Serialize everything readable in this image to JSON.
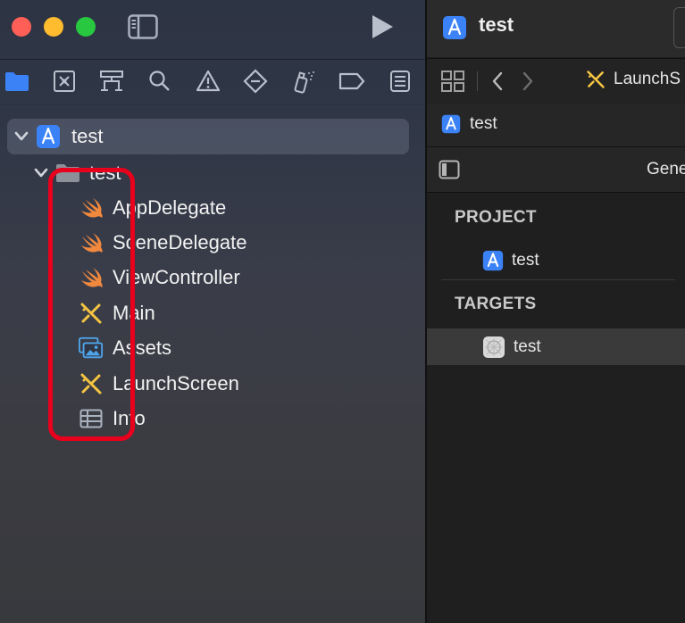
{
  "toolbar": {
    "run_icon": "play-icon",
    "sidebar_icon": "sidebar-icon"
  },
  "navigator_tabs": [
    {
      "name": "project-navigator",
      "icon": "folder-icon",
      "active": true
    },
    {
      "name": "source-control",
      "icon": "source-control-icon"
    },
    {
      "name": "symbols",
      "icon": "hierarchy-icon"
    },
    {
      "name": "find",
      "icon": "search-icon"
    },
    {
      "name": "issues",
      "icon": "warning-icon"
    },
    {
      "name": "tests",
      "icon": "diamond-icon"
    },
    {
      "name": "debug",
      "icon": "spray-icon"
    },
    {
      "name": "breakpoints",
      "icon": "tag-icon"
    },
    {
      "name": "reports",
      "icon": "list-icon"
    }
  ],
  "tree": {
    "project": {
      "label": "test"
    },
    "group": {
      "label": "test"
    },
    "files": [
      {
        "label": "AppDelegate",
        "icon": "swift-icon"
      },
      {
        "label": "SceneDelegate",
        "icon": "swift-icon"
      },
      {
        "label": "ViewController",
        "icon": "swift-icon"
      },
      {
        "label": "Main",
        "icon": "storyboard-icon"
      },
      {
        "label": "Assets",
        "icon": "assets-icon"
      },
      {
        "label": "LaunchScreen",
        "icon": "storyboard-icon"
      },
      {
        "label": "Info",
        "icon": "table-icon"
      }
    ]
  },
  "editor": {
    "window_title": "test",
    "jump_tab": "LaunchS",
    "crumb": "test",
    "tab_partial": "Gene",
    "project_header": "PROJECT",
    "project_item": "test",
    "targets_header": "TARGETS",
    "target_item": "test"
  },
  "colors": {
    "accent_blue": "#3b82f6",
    "swift_orange": "#f0883e",
    "storyboard_yellow": "#f5c542",
    "highlight_red": "#e8001c"
  }
}
